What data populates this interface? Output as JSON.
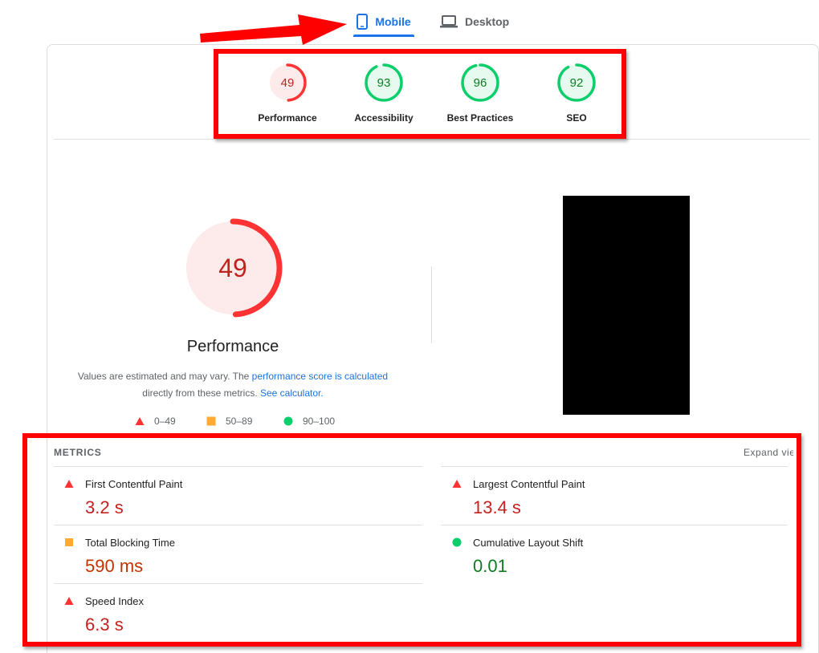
{
  "tabs": [
    {
      "label": "Mobile",
      "icon": "phone-icon",
      "active": true
    },
    {
      "label": "Desktop",
      "icon": "laptop-icon",
      "active": false
    }
  ],
  "summary_gauges": [
    {
      "score": "49",
      "label": "Performance",
      "level": 0.49,
      "status": "fail"
    },
    {
      "score": "93",
      "label": "Accessibility",
      "level": 0.93,
      "status": "pass"
    },
    {
      "score": "96",
      "label": "Best Practices",
      "level": 0.96,
      "status": "pass"
    },
    {
      "score": "92",
      "label": "SEO",
      "level": 0.92,
      "status": "pass"
    }
  ],
  "performance": {
    "score": "49",
    "level": 0.49,
    "title": "Performance",
    "note_text_1": "Values are estimated and may vary. The ",
    "note_link_1": "performance score is calculated",
    "note_text_2": "directly from these metrics. ",
    "note_link_2": "See calculator."
  },
  "legend": [
    {
      "range": "0–49",
      "shape": "triangle",
      "color": "#ff3333"
    },
    {
      "range": "50–89",
      "shape": "square",
      "color": "#ffaa33"
    },
    {
      "range": "90–100",
      "shape": "circle",
      "color": "#0cce6b"
    }
  ],
  "metrics": {
    "heading": "METRICS",
    "expand_label": "Expand view",
    "items": [
      {
        "name": "First Contentful Paint",
        "value": "3.2 s",
        "status": "fail"
      },
      {
        "name": "Largest Contentful Paint",
        "value": "13.4 s",
        "status": "fail"
      },
      {
        "name": "Total Blocking Time",
        "value": "590 ms",
        "status": "average"
      },
      {
        "name": "Cumulative Layout Shift",
        "value": "0.01",
        "status": "pass"
      },
      {
        "name": "Speed Index",
        "value": "6.3 s",
        "status": "fail"
      }
    ]
  },
  "colors": {
    "fail": "#ff3333",
    "fail_bg": "#fdeaea",
    "fail_text": "#c5221f",
    "average": "#ffaa33",
    "average_text": "#c33300",
    "pass": "#0cce6b",
    "pass_bg": "#e6faef",
    "pass_text": "#0d7d21",
    "accent": "#1a73e8",
    "annotation": "#ff0000"
  }
}
